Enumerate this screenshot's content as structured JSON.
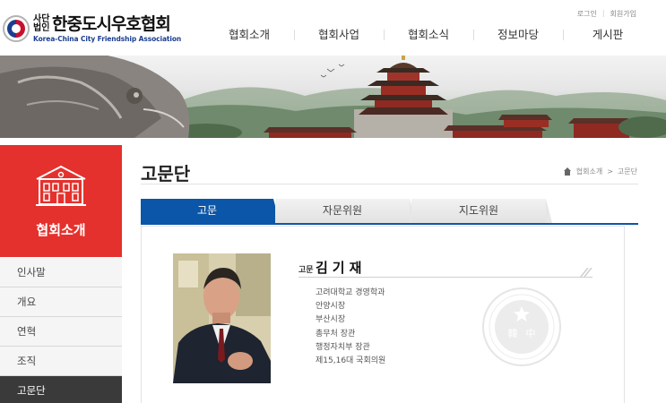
{
  "header": {
    "logo": {
      "small_top": "사단",
      "small_bottom": "법인",
      "name": "한중도시우호협회",
      "eng": "Korea-China City Friendship Association",
      "emblem_char": "韓"
    },
    "util": {
      "login": "로그인",
      "join": "회원가입"
    },
    "nav": [
      "협회소개",
      "협회사업",
      "협회소식",
      "정보마당",
      "게시판"
    ]
  },
  "sidebar": {
    "title": "협회소개",
    "items": [
      {
        "label": "인사말",
        "active": false
      },
      {
        "label": "개요",
        "active": false
      },
      {
        "label": "연혁",
        "active": false
      },
      {
        "label": "조직",
        "active": false
      },
      {
        "label": "고문단",
        "active": true
      }
    ]
  },
  "content": {
    "page_title": "고문단",
    "breadcrumb": {
      "level1": "협회소개",
      "sep": ">",
      "level2": "고문단"
    },
    "tabs": [
      "고문",
      "자문위원",
      "지도위원"
    ],
    "person": {
      "role": "고문",
      "name": "김기재",
      "career": [
        "고려대학교 경영학과",
        "안양시장",
        "부산시장",
        "총무처 장관",
        "행정자치부 장관",
        "제15,16대 국회의원"
      ]
    },
    "seal": {
      "ring_text": "사단법인한중도시우호협회 KOREA-CHINA CITY FRIENDSHIP ASSOCIATION",
      "char_left": "韓",
      "char_right": "中"
    }
  },
  "colors": {
    "brand_red": "#e4312d",
    "tab_blue": "#0b56a8",
    "active_side": "#3a3a3a"
  }
}
